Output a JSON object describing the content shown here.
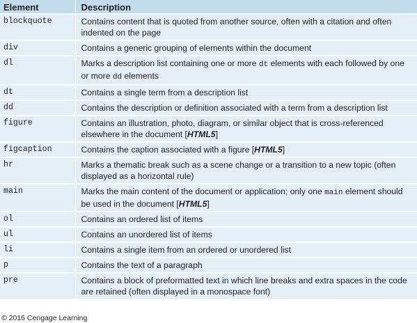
{
  "header": {
    "element": "Element",
    "description": "Description"
  },
  "rows": [
    {
      "element": "blockquote",
      "description": [
        {
          "t": "Contains content that is quoted from another source, often with a citation and often indented on the page"
        }
      ]
    },
    {
      "element": "div",
      "description": [
        {
          "t": "Contains a generic grouping of elements within the document"
        }
      ]
    },
    {
      "element": "dl",
      "description": [
        {
          "t": "Marks a description list containing one or more "
        },
        {
          "t": "dt",
          "s": "code"
        },
        {
          "t": " elements with each followed by one or more "
        },
        {
          "t": "dd",
          "s": "code"
        },
        {
          "t": " elements"
        }
      ]
    },
    {
      "element": "dt",
      "description": [
        {
          "t": "Contains a single term from a description list"
        }
      ]
    },
    {
      "element": "dd",
      "description": [
        {
          "t": "Contains the description or definition associated with a term from a description list"
        }
      ]
    },
    {
      "element": "figure",
      "description": [
        {
          "t": "Contains an illustration, photo, diagram, or similar object that is cross-referenced elsewhere in the document ["
        },
        {
          "t": "HTML5",
          "s": "h5"
        },
        {
          "t": "]"
        }
      ]
    },
    {
      "element": "figcaption",
      "description": [
        {
          "t": "Contains the caption associated with a figure ["
        },
        {
          "t": "HTML5",
          "s": "h5"
        },
        {
          "t": "]"
        }
      ]
    },
    {
      "element": "hr",
      "description": [
        {
          "t": "Marks a thematic break such as a scene change or a transition to a new topic (often displayed as a horizontal rule)"
        }
      ]
    },
    {
      "element": "main",
      "description": [
        {
          "t": "Marks the main content of the document or application; only one "
        },
        {
          "t": "main",
          "s": "code"
        },
        {
          "t": " element should be used in the document ["
        },
        {
          "t": "HTML5",
          "s": "h5"
        },
        {
          "t": "]"
        }
      ]
    },
    {
      "element": "ol",
      "description": [
        {
          "t": "Contains an ordered list of items"
        }
      ]
    },
    {
      "element": "ul",
      "description": [
        {
          "t": "Contains an unordered list of items"
        }
      ]
    },
    {
      "element": "li",
      "description": [
        {
          "t": "Contains a single item from an ordered or unordered list"
        }
      ]
    },
    {
      "element": "p",
      "description": [
        {
          "t": "Contains the text of a paragraph"
        }
      ]
    },
    {
      "element": "pre",
      "description": [
        {
          "t": "Contains a block of preformatted text in which line breaks and extra spaces in the code are retained (often displayed in a monospace font)"
        }
      ]
    }
  ],
  "footer": {
    "copyright": "© 2016 Cengage Learning"
  },
  "colors": {
    "header_bg": "#c3dcec",
    "row_bg": "#e3eef6",
    "text": "#231f20"
  }
}
